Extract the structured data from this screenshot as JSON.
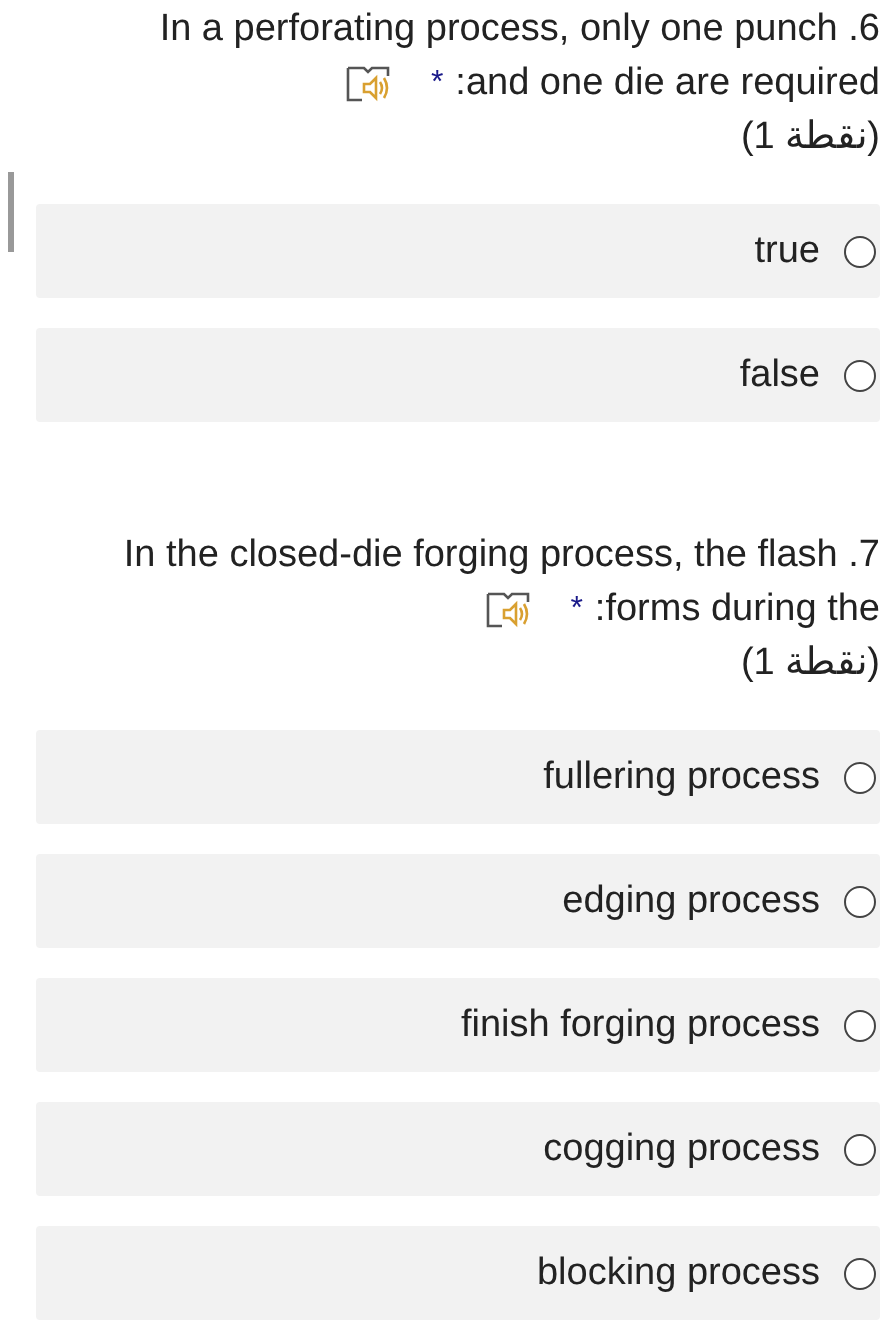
{
  "questions": [
    {
      "line_1": "In a perforating process, only one punch .6",
      "line_2": ":and one die are required",
      "required_mark": "*",
      "points": "(1 نقطة)",
      "options": [
        {
          "label": "true",
          "selected": false
        },
        {
          "label": "false",
          "selected": false
        }
      ]
    },
    {
      "line_1": "In the closed-die forging process, the flash .7",
      "line_2": ":forms during the",
      "required_mark": "*",
      "points": "(1 نقطة)",
      "options": [
        {
          "label": "fullering process",
          "selected": false
        },
        {
          "label": "edging process",
          "selected": false
        },
        {
          "label": "finish forging process",
          "selected": false
        },
        {
          "label": "cogging process",
          "selected": false
        },
        {
          "label": "blocking process",
          "selected": false
        }
      ]
    }
  ]
}
